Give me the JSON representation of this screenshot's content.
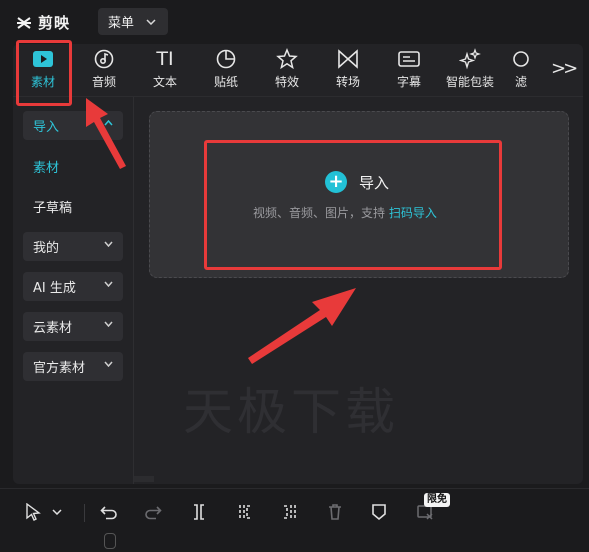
{
  "app": {
    "name": "剪映"
  },
  "header": {
    "menu_label": "菜单"
  },
  "tabs": [
    {
      "label": "素材",
      "icon": "play-square-icon",
      "active": true
    },
    {
      "label": "音频",
      "icon": "music-disc-icon"
    },
    {
      "label": "文本",
      "icon": "text-ti-icon",
      "glyph": "TI"
    },
    {
      "label": "贴纸",
      "icon": "sticker-clock-icon"
    },
    {
      "label": "特效",
      "icon": "effect-star-icon"
    },
    {
      "label": "转场",
      "icon": "transition-bowtie-icon"
    },
    {
      "label": "字幕",
      "icon": "subtitle-icon"
    },
    {
      "label": "智能包装",
      "icon": "sparkle-icon"
    },
    {
      "label": "滤",
      "icon": "filter-icon"
    }
  ],
  "tabbar": {
    "more_glyph": ">>"
  },
  "sidebar": {
    "items": [
      {
        "label": "导入",
        "state": "active",
        "has_chevron": true
      },
      {
        "label": "素材",
        "state": "teal",
        "has_chevron": false
      },
      {
        "label": "子草稿",
        "state": "plain",
        "has_chevron": false
      },
      {
        "label": "我的",
        "state": "boxed",
        "has_chevron": true
      },
      {
        "label": "AI 生成",
        "state": "boxed",
        "has_chevron": true
      },
      {
        "label": "云素材",
        "state": "boxed",
        "has_chevron": true
      },
      {
        "label": "官方素材",
        "state": "boxed",
        "has_chevron": true
      }
    ]
  },
  "dropzone": {
    "title": "导入",
    "hint_prefix": "视频、音频、图片，支持",
    "hint_link": "扫码导入"
  },
  "watermark": "天极下载",
  "toolbar": {
    "badge": "限免",
    "tools": [
      "select-cursor-icon",
      "chevron-down-icon",
      "undo-icon",
      "redo-icon",
      "split-icon",
      "split-left-icon",
      "split-right-icon",
      "delete-icon",
      "marker-icon",
      "freeze-icon"
    ]
  },
  "colors": {
    "accent": "#2ec4d8",
    "annotation": "#e83a3a",
    "panel": "#232326",
    "background": "#1b1b1d"
  }
}
